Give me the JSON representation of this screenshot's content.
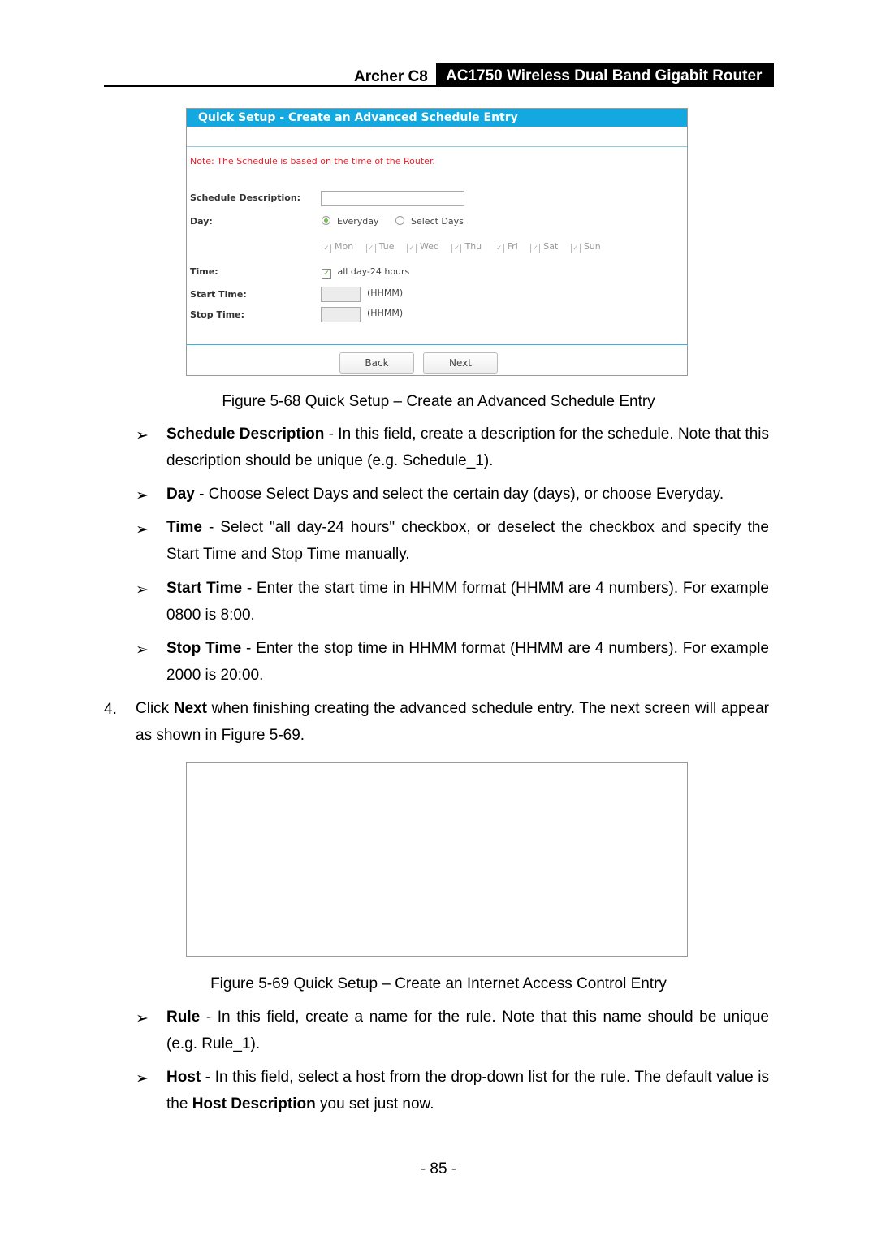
{
  "header": {
    "model": "Archer C8",
    "product": "AC1750 Wireless Dual Band Gigabit Router"
  },
  "figure68": {
    "title": "Quick Setup - Create an Advanced Schedule Entry",
    "note": "Note: The Schedule is based on the time of the Router.",
    "schedule_description_label": "Schedule Description:",
    "schedule_description_value": "",
    "day_label": "Day:",
    "day_options": [
      "Everyday",
      "Select Days"
    ],
    "day_selected": "Everyday",
    "days": [
      "Mon",
      "Tue",
      "Wed",
      "Thu",
      "Fri",
      "Sat",
      "Sun"
    ],
    "time_label": "Time:",
    "all_day_label": "all day-24 hours",
    "all_day_checked": true,
    "start_time_label": "Start Time:",
    "stop_time_label": "Stop Time:",
    "hhmm": "(HHMM)",
    "back": "Back",
    "next": "Next",
    "colors": {
      "title_bar": "#14a8e0",
      "note": "#e8202a"
    },
    "caption": "Figure 5-68 Quick Setup – Create an Advanced Schedule Entry"
  },
  "bullets1": [
    {
      "term": "Schedule Description",
      "text": " - In this field, create a description for the schedule. Note that this description should be unique (e.g. Schedule_1)."
    },
    {
      "term": "Day",
      "text": " - Choose Select Days and select the certain day (days), or choose Everyday."
    },
    {
      "term": "Time",
      "text": " - Select \"all day-24 hours\" checkbox, or deselect the checkbox and specify the Start Time and Stop Time manually."
    },
    {
      "term": "Start Time",
      "text": " - Enter the start time in HHMM format (HHMM are 4 numbers). For example 0800 is 8:00."
    },
    {
      "term": "Stop Time",
      "text": " - Enter the stop time in HHMM format (HHMM are 4 numbers). For example 2000 is 20:00."
    }
  ],
  "step4": {
    "num": "4.",
    "pre": "Click ",
    "bold": "Next",
    "post": " when finishing creating the advanced schedule entry. The next screen will appear as shown in Figure 5-69."
  },
  "figure69": {
    "caption": "Figure 5-69 Quick Setup – Create an Internet Access Control Entry"
  },
  "bullets2": [
    {
      "term": "Rule",
      "text": " - In this field, create a name for the rule. Note that this name should be unique (e.g. Rule_1)."
    },
    {
      "term": "Host",
      "text": " - In this field, select a host from the drop-down list for the rule. The default value is the ",
      "bold2": "Host Description",
      "text2": " you set just now."
    }
  ],
  "bullet_glyph": "➢",
  "page_number": "- 85 -"
}
